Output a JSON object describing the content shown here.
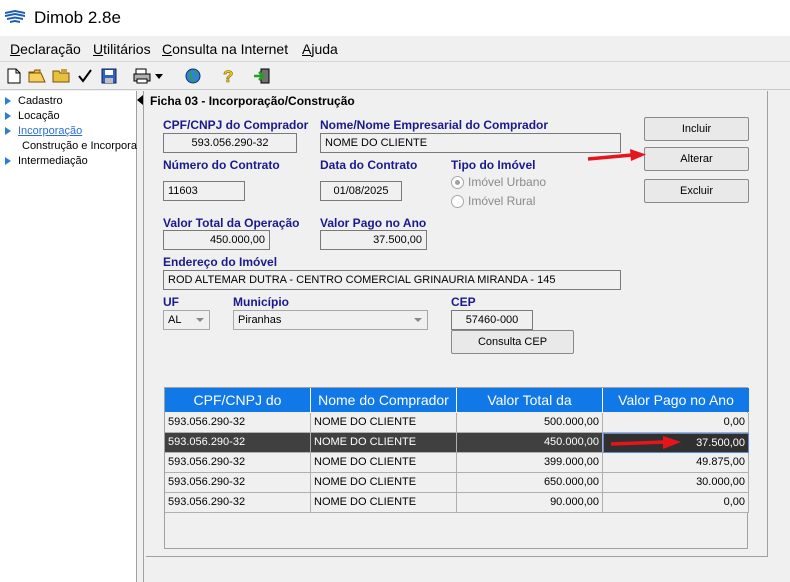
{
  "window": {
    "title": "Dimob 2.8e"
  },
  "menu": [
    {
      "label": "Declaração",
      "u": "D"
    },
    {
      "label": "Utilitários",
      "u": "U"
    },
    {
      "label": "Consulta na Internet",
      "u": "C"
    },
    {
      "label": "Ajuda",
      "u": "A"
    }
  ],
  "tree": {
    "cadastro": "Cadastro",
    "locacao": "Locação",
    "incorporacao": "Incorporação",
    "construcao": "Construção e Incorpora",
    "intermediacao": "Intermediação"
  },
  "panel": {
    "title": "Ficha 03 - Incorporação/Construção",
    "cpf_label": "CPF/CNPJ do Comprador",
    "cpf_value": "593.056.290-32",
    "nome_label": "Nome/Nome Empresarial do Comprador",
    "nome_value": "NOME DO CLIENTE",
    "contrato_label": "Número do Contrato",
    "contrato_value": "11603",
    "data_label": "Data do Contrato",
    "data_value": "01/08/2025",
    "tipo_label": "Tipo do Imóvel",
    "tipo_urbano": "Imóvel Urbano",
    "tipo_rural": "Imóvel Rural",
    "valor_total_label": "Valor Total da Operação",
    "valor_total_value": "450.000,00",
    "valor_pago_label": "Valor Pago no Ano",
    "valor_pago_value": "37.500,00",
    "endereco_label": "Endereço do Imóvel",
    "endereco_value": "ROD ALTEMAR DUTRA - CENTRO COMERCIAL GRINAURIA MIRANDA - 145",
    "uf_label": "UF",
    "uf_value": "AL",
    "municipio_label": "Município",
    "municipio_value": "Piranhas",
    "cep_label": "CEP",
    "cep_value": "57460-000"
  },
  "buttons": {
    "incluir": "Incluir",
    "alterar": "Alterar",
    "excluir": "Excluir",
    "consulta_cep": "Consulta CEP"
  },
  "grid": {
    "headers": [
      "CPF/CNPJ do",
      "Nome do Comprador",
      "Valor Total da",
      "Valor Pago no Ano"
    ],
    "rows": [
      [
        "593.056.290-32",
        "NOME DO CLIENTE",
        "500.000,00",
        "0,00"
      ],
      [
        "593.056.290-32",
        "NOME DO CLIENTE",
        "450.000,00",
        "37.500,00"
      ],
      [
        "593.056.290-32",
        "NOME DO CLIENTE",
        "399.000,00",
        "49.875,00"
      ],
      [
        "593.056.290-32",
        "NOME DO CLIENTE",
        "650.000,00",
        "30.000,00"
      ],
      [
        "593.056.290-32",
        "NOME DO CLIENTE",
        "90.000,00",
        "0,00"
      ]
    ],
    "selected_row": 1
  },
  "colors": {
    "header_blue": "#1178e8",
    "label_blue": "#1a1a8c",
    "annotation_red": "#e8141c"
  }
}
